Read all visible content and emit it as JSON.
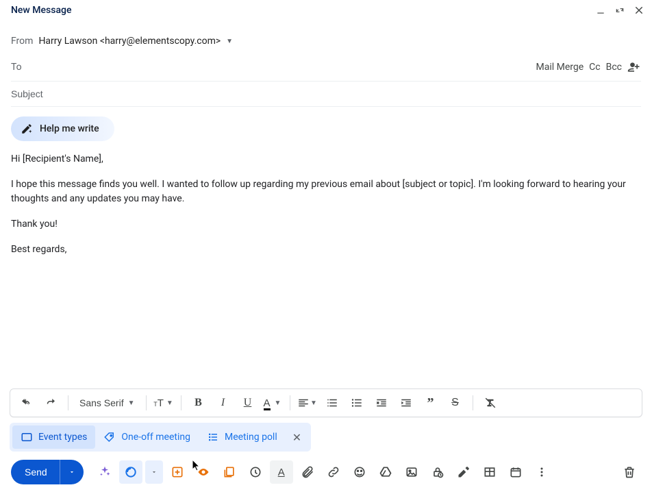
{
  "header": {
    "title": "New Message"
  },
  "from": {
    "label": "From",
    "value": "Harry Lawson <harry@elementscopy.com>"
  },
  "to": {
    "label": "To",
    "mail_merge": "Mail Merge",
    "cc": "Cc",
    "bcc": "Bcc"
  },
  "subject": {
    "placeholder": "Subject",
    "value": ""
  },
  "help_write": "Help me write",
  "body": {
    "l1": "Hi [Recipient's Name],",
    "l2": "I hope this message finds you well. I wanted to follow up regarding my previous email about [subject or topic]. I'm looking forward to hearing your thoughts and any updates you may have.",
    "l3": "Thank you!",
    "l4": "Best regards,"
  },
  "format": {
    "font": "Sans Serif"
  },
  "chips": {
    "event_types": "Event types",
    "one_off": "One-off meeting",
    "poll": "Meeting poll"
  },
  "send": "Send"
}
